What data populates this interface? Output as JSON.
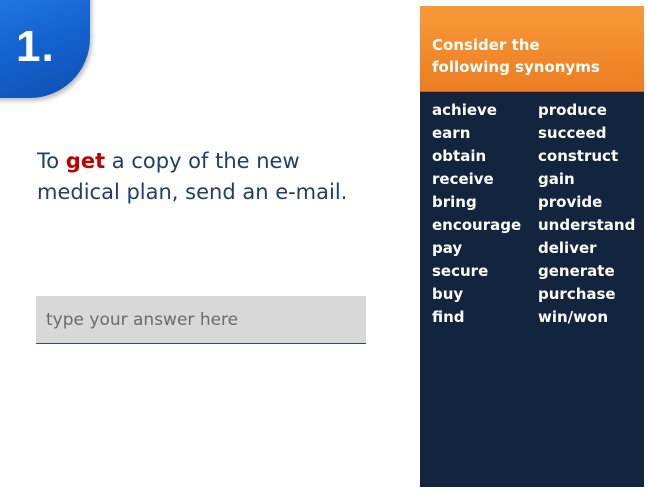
{
  "question_number": "1.",
  "sentence": {
    "before": "To ",
    "keyword": "get",
    "after": " a copy of the new medical plan, send an e-mail."
  },
  "answer_input": {
    "placeholder": "type your answer here",
    "value": ""
  },
  "synonyms_panel": {
    "title": "Consider the following synonyms",
    "column_left": [
      "achieve",
      "earn",
      "obtain",
      "receive",
      "bring",
      "encourage",
      "pay",
      "secure",
      "buy",
      "find"
    ],
    "column_right": [
      "produce",
      "succeed",
      "construct",
      "gain",
      "provide",
      "understand",
      "deliver",
      "generate",
      "purchase",
      "win/won"
    ]
  },
  "colors": {
    "badge_blue": "#1666d4",
    "question_text": "#1f3d6e",
    "keyword_red": "#c00000",
    "panel_header_orange": "#ec7d22",
    "panel_body_navy": "#13243f"
  }
}
